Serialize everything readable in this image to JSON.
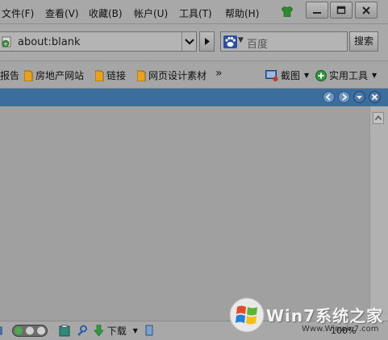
{
  "menu": [
    "文件(F)",
    "查看(V)",
    "收藏(B)",
    "帐户(U)",
    "工具(T)",
    "帮助(H)"
  ],
  "address": {
    "url": "about:blank"
  },
  "search": {
    "placeholder": "百度",
    "button": "搜索"
  },
  "favorites": {
    "partial_item": "报告",
    "items": [
      "房地产网站",
      "链接",
      "网页设计素材"
    ],
    "more": "»"
  },
  "tools": {
    "screenshot": "截图",
    "utilities": "实用工具"
  },
  "status": {
    "download": "下载",
    "zoom": "100%"
  },
  "watermark": {
    "brand": "Win7系统之家",
    "url": "Www.Winwin7.com"
  },
  "colors": {
    "panel_header": "#3c6e9c",
    "background": "#a0a0a0"
  }
}
